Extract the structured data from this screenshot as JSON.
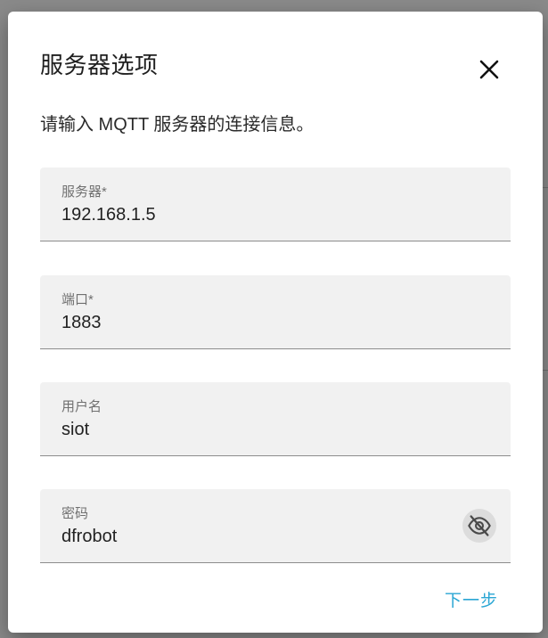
{
  "dialog": {
    "title": "服务器选项",
    "description": "请输入 MQTT 服务器的连接信息。",
    "close_icon": "close-icon"
  },
  "fields": {
    "server": {
      "label": "服务器*",
      "value": "192.168.1.5"
    },
    "port": {
      "label": "端口*",
      "value": "1883"
    },
    "username": {
      "label": "用户名",
      "value": "siot"
    },
    "password": {
      "label": "密码",
      "value": "dfrobot",
      "toggle_icon": "eye-off-icon"
    }
  },
  "actions": {
    "next_label": "下一步"
  },
  "colors": {
    "accent": "#2aa6d4",
    "field_background": "#f1f1f1",
    "text_primary": "#222222",
    "label_text": "#707070"
  }
}
